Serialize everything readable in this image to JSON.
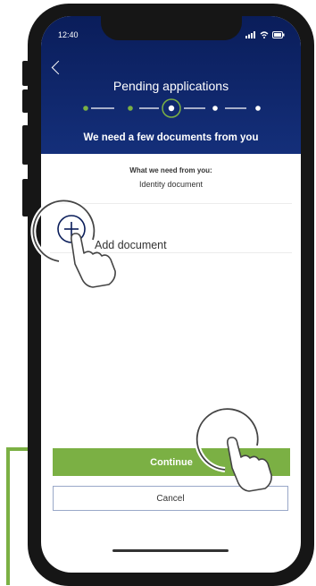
{
  "status_bar": {
    "time": "12:40"
  },
  "header": {
    "title": "Pending applications",
    "subtitle": "We need a few documents from you",
    "steps_total": 5,
    "current_step": 3
  },
  "requirements": {
    "label": "What we need from you:",
    "document": "Identity document"
  },
  "add_document": {
    "label": "Add document"
  },
  "actions": {
    "continue_label": "Continue",
    "cancel_label": "Cancel"
  },
  "colors": {
    "header": "#0a1d5a",
    "accent_green": "#7bb044",
    "callout": "#7bb044"
  },
  "icons": {
    "back": "chevron-left-icon",
    "add": "plus-circle-icon",
    "tap_gesture": "hand-tap-icon"
  }
}
